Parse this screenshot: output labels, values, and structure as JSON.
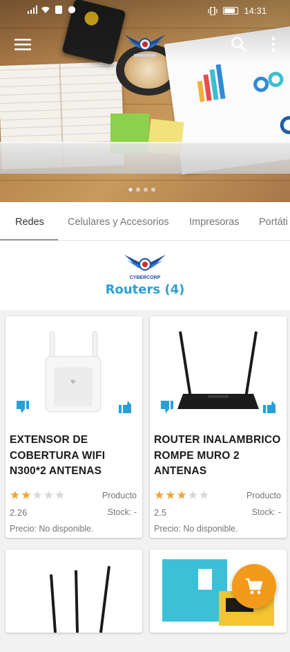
{
  "status_bar": {
    "time": "14:31",
    "icons": [
      "signal-icon",
      "wifi-icon",
      "whatsapp-icon",
      "vibrate-icon",
      "battery-icon"
    ]
  },
  "app_bar": {
    "menu_icon": "hamburger-menu-icon",
    "search_icon": "search-icon",
    "overflow_icon": "overflow-menu-icon"
  },
  "hero": {
    "slides_total": 4,
    "active_slide": 1
  },
  "tabs": [
    {
      "label": "Redes",
      "active": true
    },
    {
      "label": "Celulares y Accesorios",
      "active": false
    },
    {
      "label": "Impresoras",
      "active": false
    },
    {
      "label": "Portáti",
      "active": false
    }
  ],
  "brand": {
    "logo_text": "CYBERCORP"
  },
  "category": {
    "title": "Routers (4)"
  },
  "products": [
    {
      "name": "EXTENSOR DE COBERTURA WIFI N300*2 ANTENAS",
      "stars": 2,
      "max_stars": 5,
      "type": "Producto",
      "rating": "2.26",
      "stock": "Stock: -",
      "price": "Precio: No disponible."
    },
    {
      "name": "ROUTER INALAMBRICO ROMPE MURO 2 ANTENAS",
      "stars": 3,
      "max_stars": 5,
      "type": "Producto",
      "rating": "2.5",
      "stock": "Stock: -",
      "price": "Precio: No disponible."
    }
  ],
  "colors": {
    "accent_blue": "#2a9fd6",
    "star_orange": "#f0a22e",
    "fab_orange": "#f39a1c",
    "vote_blue": "#2a9fd6"
  },
  "fab": {
    "icon": "shopping-cart-icon"
  }
}
